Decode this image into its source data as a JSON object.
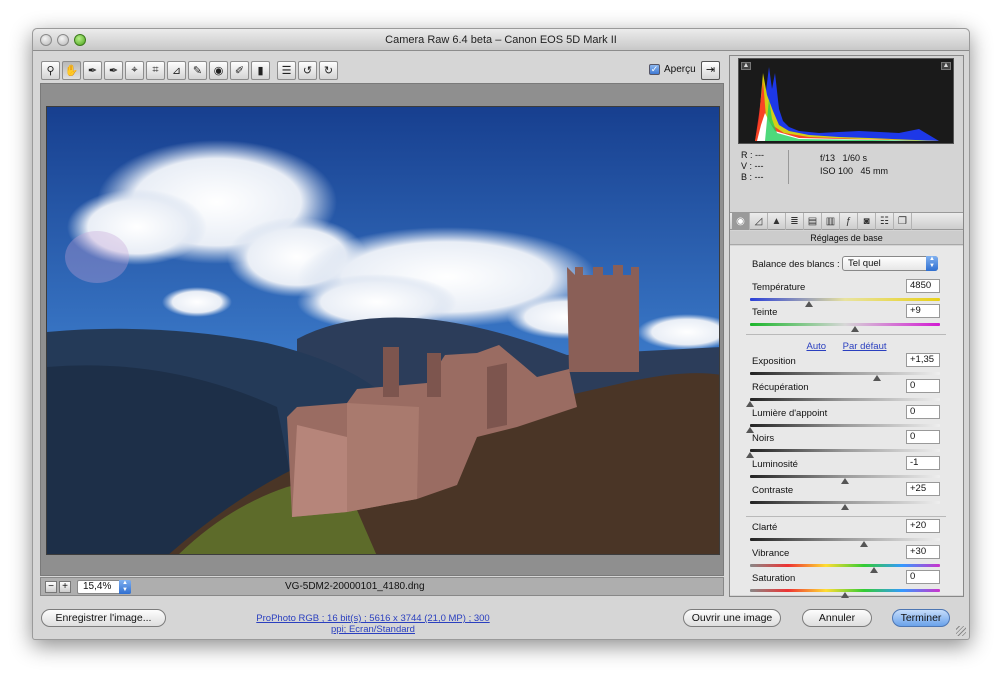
{
  "window": {
    "title": "Camera Raw 6.4 beta  –  Canon EOS 5D Mark II"
  },
  "toolbar": {
    "tools": [
      {
        "name": "zoom-tool",
        "glyph": "⚲"
      },
      {
        "name": "hand-tool",
        "glyph": "✋"
      },
      {
        "name": "white-balance-tool",
        "glyph": "✒"
      },
      {
        "name": "color-sampler-tool",
        "glyph": "✒"
      },
      {
        "name": "targeted-adjustment-tool",
        "glyph": "⌖"
      },
      {
        "name": "crop-tool",
        "glyph": "⌗"
      },
      {
        "name": "straighten-tool",
        "glyph": "⊿"
      },
      {
        "name": "spot-removal-tool",
        "glyph": "✎"
      },
      {
        "name": "red-eye-tool",
        "glyph": "◉"
      },
      {
        "name": "adjustment-brush-tool",
        "glyph": "✐"
      },
      {
        "name": "graduated-filter-tool",
        "glyph": "▮"
      },
      {
        "name": "preferences-tool",
        "glyph": "☰"
      },
      {
        "name": "rotate-left-tool",
        "glyph": "↺"
      },
      {
        "name": "rotate-right-tool",
        "glyph": "↻"
      }
    ],
    "preview_label": "Aperçu",
    "preview_checked": true
  },
  "status": {
    "zoom": "15,4%",
    "filename": "VG-5DM2-20000101_4180.dng"
  },
  "info": {
    "r": "R :  ---",
    "v": "V :  ---",
    "b": "B :  ---",
    "aperture": "f/13",
    "shutter": "1/60 s",
    "iso": "ISO 100",
    "focal": "45 mm"
  },
  "panel": {
    "title": "Réglages de base",
    "wb_label": "Balance des blancs :",
    "wb_value": "Tel quel",
    "auto_link": "Auto",
    "default_link": "Par défaut",
    "sliders": [
      {
        "label": "Température",
        "value": "4850",
        "pos": 0.31,
        "color": "temp"
      },
      {
        "label": "Teinte",
        "value": "+9",
        "pos": 0.55,
        "color": "tint"
      },
      {
        "label": "Exposition",
        "value": "+1,35",
        "pos": 0.67,
        "color": "gray"
      },
      {
        "label": "Récupération",
        "value": "0",
        "pos": 0.0,
        "color": "gray"
      },
      {
        "label": "Lumière d'appoint",
        "value": "0",
        "pos": 0.0,
        "color": "gray"
      },
      {
        "label": "Noirs",
        "value": "0",
        "pos": 0.0,
        "color": "gray"
      },
      {
        "label": "Luminosité",
        "value": "-1",
        "pos": 0.5,
        "color": "gray"
      },
      {
        "label": "Contraste",
        "value": "+25",
        "pos": 0.5,
        "color": "gray"
      },
      {
        "label": "Clarté",
        "value": "+20",
        "pos": 0.6,
        "color": "gray"
      },
      {
        "label": "Vibrance",
        "value": "+30",
        "pos": 0.65,
        "color": "sat"
      },
      {
        "label": "Saturation",
        "value": "0",
        "pos": 0.5,
        "color": "sat"
      }
    ]
  },
  "footer": {
    "save_label": "Enregistrer l'image...",
    "workflow_link": "ProPhoto RGB ; 16 bit(s) ; 5616 x 3744 (21,0 MP) ; 300 ppi; Ecran/Standard",
    "open_label": "Ouvrir une image",
    "cancel_label": "Annuler",
    "done_label": "Terminer"
  }
}
